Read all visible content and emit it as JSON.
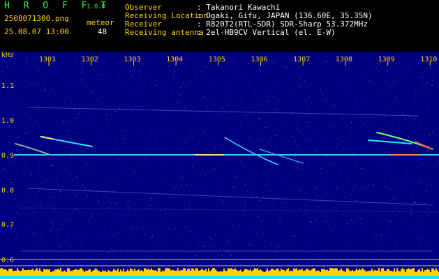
{
  "app": {
    "name": "H R O F F T",
    "version": "1.0.0"
  },
  "file": {
    "name": "2508071300.png",
    "datetime": "25.08.07 13:00"
  },
  "meteor": {
    "label": "meteor",
    "count": "48"
  },
  "info": {
    "observer_label": "Observer",
    "observer_value": ": Takanori Kawachi",
    "location_label": "Receiving Location",
    "location_value": ": Ogaki, Gifu, JAPAN (136.60E, 35.35N)",
    "receiver_label": "Receiver",
    "receiver_value": ": R820T2(RTL-SDR) SDR-Sharp 53.372MHz",
    "antenna_label": "Receiving antenna",
    "antenna_value": ": 2el-HB9CV Vertical (el. E-W)"
  },
  "axis": {
    "unit": "kHz",
    "time_ticks": [
      "1301",
      "1302",
      "1303",
      "1304",
      "1305",
      "1306",
      "1307",
      "1308",
      "1309",
      "1310"
    ],
    "freq_ticks": [
      "1.1",
      "1.0",
      "0.9",
      "0.8",
      "0.7",
      "0.6"
    ]
  },
  "colors": {
    "brand": "#2cf24a",
    "label": "#ffd400",
    "text": "#ffffff",
    "background": "#000080",
    "noise": "#2f5bd0",
    "signal": "#00e8ff",
    "bar": "#ffd400"
  }
}
